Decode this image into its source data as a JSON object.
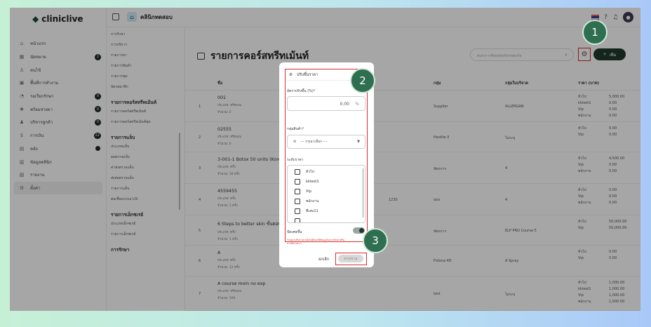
{
  "app": {
    "logo_text": "cliniclive",
    "clinic_name": "คลินิกทดสอบ"
  },
  "sidebar": {
    "items": [
      {
        "label": "หน้าแรก",
        "icon": "home-icon",
        "badge": ""
      },
      {
        "label": "นัดหมาย",
        "icon": "calendar-icon",
        "badge": "2"
      },
      {
        "label": "คนไข้",
        "icon": "user-icon",
        "badge": ""
      },
      {
        "label": "พื้นที่การทำงาน",
        "icon": "workspace-icon",
        "badge": ""
      },
      {
        "label": "รอเรียกรักษา",
        "icon": "wait-icon",
        "badge": "0"
      },
      {
        "label": "พร้อมจ่ายยา",
        "icon": "medicine-icon",
        "badge": "0"
      },
      {
        "label": "บริหารลูกค้า",
        "icon": "manage-icon",
        "badge": "0"
      },
      {
        "label": "การเงิน",
        "icon": "money-icon",
        "badge": "22"
      },
      {
        "label": "คลัง",
        "icon": "warehouse-icon",
        "badge": "dot"
      },
      {
        "label": "ข้อมูลคลินิก",
        "icon": "clinic-info-icon",
        "badge": ""
      },
      {
        "label": "รายงาน",
        "icon": "report-icon",
        "badge": ""
      },
      {
        "label": "ตั้งค่า",
        "icon": "gear-icon",
        "badge": ""
      }
    ]
  },
  "submenu": {
    "items": [
      {
        "label": "การรักษา",
        "head": false
      },
      {
        "label": "การบริการ",
        "head": false
      },
      {
        "label": "รายการยา",
        "head": false
      },
      {
        "label": "รายการสินค้า",
        "head": false
      },
      {
        "label": "รายการชุด",
        "head": false
      },
      {
        "label": "บัตรสมาชิก",
        "head": false
      },
      {
        "label": "รายการคอร์สทรีทเม้นท์",
        "head": true
      },
      {
        "label": "รายการคอร์สทรีทเม้นท์",
        "head": false
      },
      {
        "label": "รายการคอร์สทรีทเม้นท์ชุด",
        "head": false
      },
      {
        "label": "รายการแล็บ",
        "head": true
      },
      {
        "label": "ประเภทแล็บ",
        "head": false
      },
      {
        "label": "ผลตรวจแล็บ",
        "head": false
      },
      {
        "label": "ค่าส่งตรวจแล็บ",
        "head": false
      },
      {
        "label": "ส่งต่อตรวจแล็บ",
        "head": false
      },
      {
        "label": "รายการแล็บ",
        "head": false
      },
      {
        "label": "ต่อเชื่อมระบบ LIS",
        "head": false
      },
      {
        "label": "รายการเอ็กซเรย์",
        "head": true
      },
      {
        "label": "ประเภทเอ็กซเรย์",
        "head": false
      },
      {
        "label": "รายการเอ็กซเรย์",
        "head": false
      },
      {
        "label": "การรักษา",
        "head": true
      }
    ]
  },
  "main": {
    "title": "รายการคอร์สทรีทเม้นท์",
    "search_placeholder": "ค้นหาจากชื่อคอร์สหรือรหัสคอร์ส",
    "add_label": "เพิ่ม",
    "columns": [
      "ชื่อ",
      "กลุ่ม",
      "กลุ่มใบบริจาค",
      "ราคา (บาท)"
    ],
    "rows": [
      {
        "no": "1",
        "name": "001",
        "type": "ประเภท: ทรีทเมน",
        "qty": "จำนวน: 0",
        "group": "Supplier",
        "tax": "ALLERGAN",
        "prices": [
          [
            "ทั่วไป",
            "5,000.00"
          ],
          [
            "kktest1",
            "0.00"
          ],
          [
            "Vip",
            "0.00"
          ],
          [
            "พนักงาน",
            "0.00"
          ]
        ]
      },
      {
        "no": "2",
        "name": "02555",
        "type": "ประเภท: ทรีทเมน",
        "qty": "จำนวน: 6",
        "group": "Heolite II",
        "tax": "ไม่ระบุ",
        "prices": [
          [
            "ทั่วไป",
            "0.00"
          ],
          [
            "Vip",
            "0.00"
          ]
        ]
      },
      {
        "no": "3",
        "name": "3-001-1 Botox 50 units (Korea)",
        "type": "ประเภท: ครั้ง",
        "qty": "จำนวน: 10 ครั้ง",
        "group": "หัตถการ",
        "tax": "4",
        "prices": [
          [
            "ทั่วไป",
            "4,500.00"
          ],
          [
            "Vip",
            "0.00"
          ],
          [
            "พนักงาน",
            "0.00"
          ]
        ]
      },
      {
        "no": "4",
        "name": "4559455",
        "type": "ประเภท: ครั้ง",
        "qty": "จำนวน: 1 ครั้ง",
        "code": "1230",
        "group": "ooo",
        "tax": "4",
        "prices": [
          [
            "ทั่วไป",
            "0.00"
          ],
          [
            "Vip",
            "0.00"
          ],
          [
            "พนักงาน",
            "0.00"
          ]
        ]
      },
      {
        "no": "5",
        "name": "6 Steps to better skin ขั้นตอนใส",
        "type": "ประเภท: ครั้ง",
        "qty": "จำนวน: 1 ครั้ง",
        "group": "หัตถการ",
        "tax": "ELP PRO Course 5",
        "prices": [
          [
            "ทั่วไป",
            "50,000.00"
          ],
          [
            "Vip",
            "50,000.00"
          ]
        ]
      },
      {
        "no": "6",
        "name": "A",
        "type": "ประเภท: ครั้ง",
        "qty": "จำนวน: 12 ครั้ง",
        "group": "Fotona 4D",
        "tax": "A Spray",
        "prices": [
          [
            "ทั่วไป",
            "0.00"
          ],
          [
            "Vip",
            "0.00"
          ]
        ]
      },
      {
        "no": "7",
        "name": "A course moin no exp",
        "type": "ประเภท: ทรีทเมน",
        "qty": "จำนวน: 100",
        "group": "test",
        "tax": "ไม่ระบุ",
        "prices": [
          [
            "ทั่วไป",
            "1,000.00"
          ],
          [
            "kktest1",
            "1,000.00"
          ],
          [
            "Vip",
            "1,000.00"
          ],
          [
            "พนักงาน",
            "1,000.00"
          ]
        ]
      }
    ]
  },
  "modal": {
    "title": "ปรับขึ้นราคา",
    "rate_label": "อัตราปรับขึ้น (%)",
    "rate_value": "0.00",
    "rate_unit": "%",
    "group_label": "กลุ่มสินค้า",
    "group_placeholder": "--- กรุณาเลือก ---",
    "level_label": "ระดับราคา",
    "levels": [
      "ทั่วไป",
      "kktest1",
      "Vip",
      "พนักงาน",
      "ที่เสม11"
    ],
    "round_label": "ปัดเศษขึ้น",
    "note_line1": "*กรุณาปรับราคาเมื่อไม่มีคนใช้ข้อมูลในการรักษาหรือ",
    "note_line2": "การสั่งราคาฯ",
    "cancel_label": "ยกเลิก",
    "save_label": "ตามขวน"
  },
  "callouts": [
    "1",
    "2",
    "3"
  ]
}
